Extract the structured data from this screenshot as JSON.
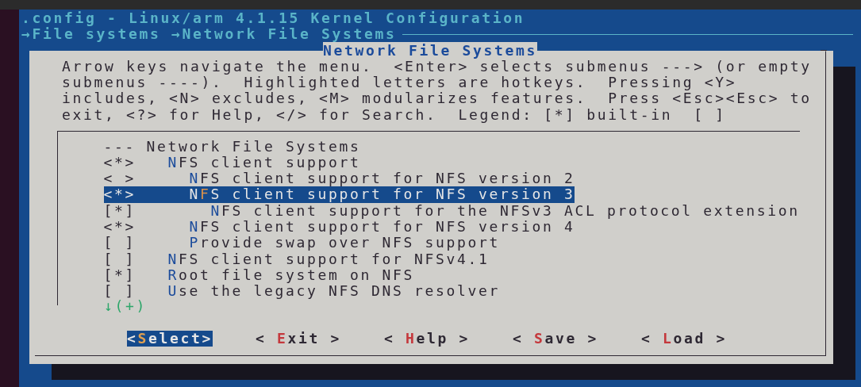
{
  "window": {
    "title": ".config - Linux/arm 4.1.15 Kernel Configuration",
    "breadcrumb": "→File systems →Network File Systems"
  },
  "dialog": {
    "title": "Network File Systems",
    "help": "Arrow keys navigate the menu.  <Enter> selects submenus ---> (or empty submenus ----).  Highlighted letters are hotkeys.  Pressing <Y> includes, <N> excludes, <M> modularizes features.  Press <Esc><Esc> to exit, <?> for Help, </> for Search.  Legend: [*] built-in  [ ]",
    "menu": {
      "items": [
        {
          "kind": "comment",
          "marker": "---",
          "label": "Network File Systems",
          "selected": false
        },
        {
          "kind": "option",
          "marker": "<*>",
          "label": "**N**FS client support",
          "selected": false,
          "children": [
            {
              "kind": "option",
              "marker": "< >",
              "label": "**N**FS client support for NFS version 2",
              "selected": false
            },
            {
              "kind": "option",
              "marker": "<*>",
              "label": "N**F**S client support for NFS version 3",
              "selected": true,
              "children": [
                {
                  "kind": "option",
                  "marker": "[*]",
                  "label": "**N**FS client support for the NFSv3 ACL protocol extension",
                  "selected": false
                }
              ]
            },
            {
              "kind": "option",
              "marker": "<*>",
              "label": "**N**FS client support for NFS version 4",
              "selected": false
            },
            {
              "kind": "option",
              "marker": "[ ]",
              "label": "**P**rovide swap over NFS support",
              "selected": false
            }
          ]
        },
        {
          "kind": "option",
          "marker": "[ ]",
          "label": "**N**FS client support for NFSv4.1",
          "selected": false
        },
        {
          "kind": "option",
          "marker": "[*]",
          "label": "**R**oot file system on NFS",
          "selected": false
        },
        {
          "kind": "option",
          "marker": "[ ]",
          "label": "**U**se the legacy NFS DNS resolver",
          "selected": false
        }
      ],
      "more_indicator": "↓(+)"
    },
    "buttons": [
      {
        "label": "<**S**elect>",
        "selected": true
      },
      {
        "label": "< **E**xit >",
        "selected": false
      },
      {
        "label": "< **H**elp >",
        "selected": false
      },
      {
        "label": "< **S**ave >",
        "selected": false
      },
      {
        "label": "< **L**oad >",
        "selected": false
      }
    ]
  }
}
